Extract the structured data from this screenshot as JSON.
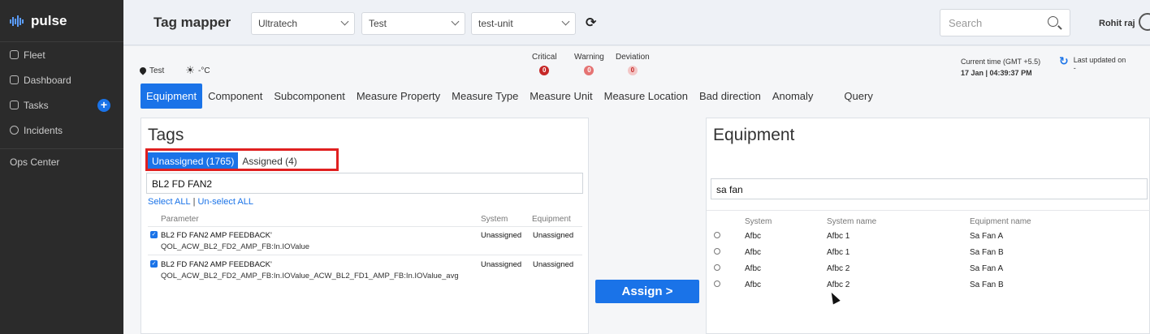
{
  "app": {
    "name": "pulse"
  },
  "sidebar": {
    "items": [
      {
        "label": "Fleet",
        "icon": "fleet-icon"
      },
      {
        "label": "Dashboard",
        "icon": "dashboard-icon"
      },
      {
        "label": "Tasks",
        "icon": "tasks-icon"
      },
      {
        "label": "Incidents",
        "icon": "info-icon"
      }
    ],
    "ops": "Ops Center"
  },
  "header": {
    "title": "Tag mapper",
    "selects": [
      "Ultratech",
      "Test",
      "test-unit"
    ],
    "search_placeholder": "Search",
    "user": "Rohit raj"
  },
  "info": {
    "location": "Test",
    "temperature": "-°C",
    "status": [
      {
        "label": "Critical",
        "count": "0",
        "color": "#c62828"
      },
      {
        "label": "Warning",
        "count": "0",
        "color": "#e57373"
      },
      {
        "label": "Deviation",
        "count": "0",
        "color": "#f3c7c7"
      }
    ],
    "current_time_label": "Current time (GMT +5.5)",
    "current_time": "17 Jan | 04:39:37 PM",
    "last_updated_label": "Last updated on",
    "last_updated": "-"
  },
  "tabs": [
    "Equipment",
    "Component",
    "Subcomponent",
    "Measure Property",
    "Measure Type",
    "Measure Unit",
    "Measure Location",
    "Bad direction",
    "Anomaly",
    "Query"
  ],
  "tags": {
    "title": "Tags",
    "unassigned": "Unassigned (1765)",
    "assigned": "Assigned (4)",
    "filter": "BL2 FD FAN2",
    "select_all": "Select ALL",
    "unselect_all": "Un-select ALL",
    "columns": [
      "Parameter",
      "System",
      "Equipment"
    ],
    "rows": [
      {
        "name": "BL2 FD FAN2 AMP FEEDBACK'",
        "tag": "QOL_ACW_BL2_FD2_AMP_FB:In.IOValue",
        "system": "Unassigned",
        "equipment": "Unassigned"
      },
      {
        "name": "BL2 FD FAN2 AMP FEEDBACK'",
        "tag": "QOL_ACW_BL2_FD2_AMP_FB:In.IOValue_ACW_BL2_FD1_AMP_FB:In.IOValue_avg",
        "system": "Unassigned",
        "equipment": "Unassigned"
      }
    ]
  },
  "assign_label": "Assign >",
  "equipment": {
    "title": "Equipment",
    "filter": "sa fan",
    "columns": [
      "System",
      "System name",
      "Equipment name"
    ],
    "rows": [
      {
        "system": "Afbc",
        "system_name": "Afbc 1",
        "equipment_name": "Sa Fan A"
      },
      {
        "system": "Afbc",
        "system_name": "Afbc 1",
        "equipment_name": "Sa Fan B"
      },
      {
        "system": "Afbc",
        "system_name": "Afbc 2",
        "equipment_name": "Sa Fan A"
      },
      {
        "system": "Afbc",
        "system_name": "Afbc 2",
        "equipment_name": "Sa Fan B"
      }
    ]
  }
}
